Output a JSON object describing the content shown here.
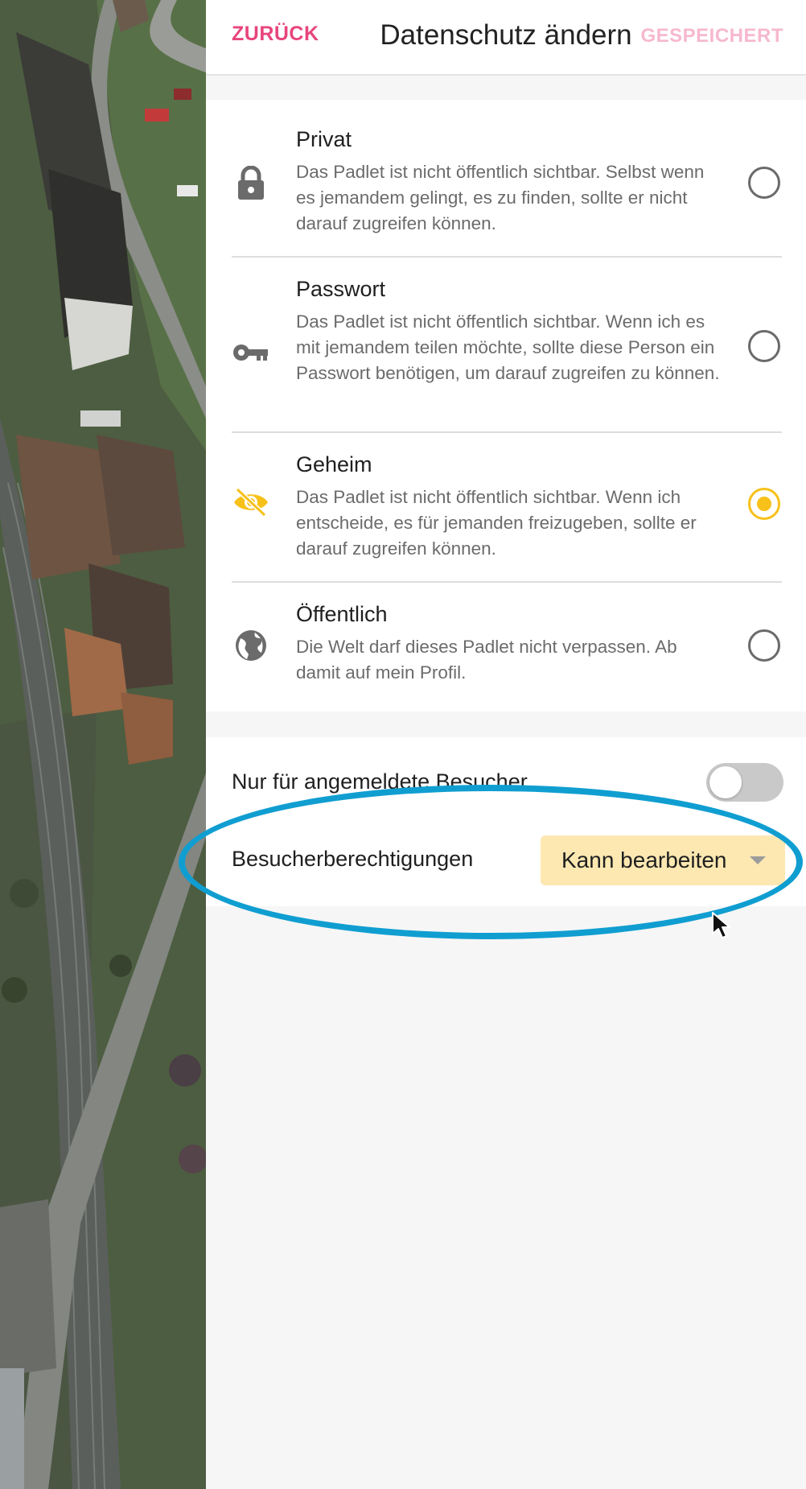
{
  "header": {
    "back_label": "ZURÜCK",
    "title": "Datenschutz ändern",
    "saved_label": "GESPEICHERT"
  },
  "privacy_options": [
    {
      "icon": "lock-icon",
      "title": "Privat",
      "description": "Das Padlet ist nicht öffentlich sichtbar. Selbst wenn es jemandem gelingt, es zu finden, sollte er nicht darauf zugreifen können.",
      "selected": false
    },
    {
      "icon": "key-icon",
      "title": "Passwort",
      "description": "Das Padlet ist nicht öffentlich sichtbar. Wenn ich es mit jemandem teilen möchte, sollte diese Person ein Passwort benötigen, um darauf zugreifen zu können.",
      "selected": false
    },
    {
      "icon": "eye-off-icon",
      "title": "Geheim",
      "description": "Das Padlet ist nicht öffentlich sichtbar. Wenn ich entscheide, es für jemanden freizugeben, sollte er darauf zugreifen können.",
      "selected": true
    },
    {
      "icon": "globe-icon",
      "title": "Öffentlich",
      "description": "Die Welt darf dieses Padlet nicht verpassen. Ab damit auf mein Profil.",
      "selected": false
    }
  ],
  "settings": {
    "login_only_label": "Nur für angemeldete Besucher",
    "login_only_enabled": false,
    "permissions_label": "Besucherberechtigungen",
    "permissions_value": "Kann bearbeiten"
  },
  "colors": {
    "accent_pink": "#e8457c",
    "accent_yellow": "#f7c11a",
    "highlight_blue": "#109ed1",
    "select_bg": "#fde8b2"
  }
}
